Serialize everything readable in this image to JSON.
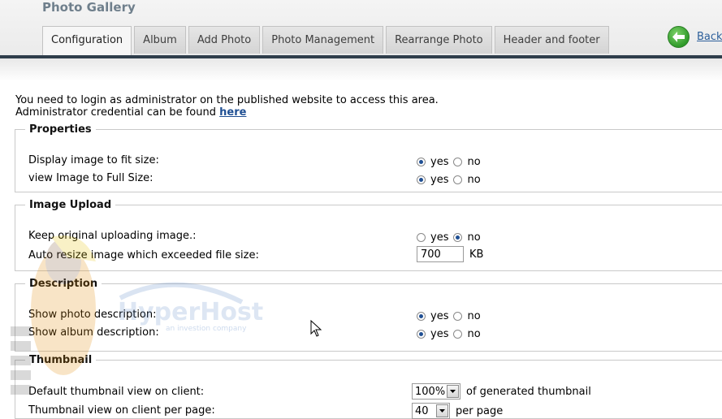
{
  "page": {
    "title": "Photo Gallery"
  },
  "tabs": [
    {
      "label": "Configuration",
      "active": true
    },
    {
      "label": "Album"
    },
    {
      "label": "Add Photo"
    },
    {
      "label": "Photo Management"
    },
    {
      "label": "Rearrange Photo"
    },
    {
      "label": "Header and footer"
    }
  ],
  "back": {
    "label": "Back",
    "icon": "arrow-left-icon"
  },
  "notice": {
    "line1": "You need to login as administrator on the published website to access this area.",
    "line2_prefix": "Administrator credential can be found ",
    "link": "here"
  },
  "options": {
    "yes": "yes",
    "no": "no"
  },
  "properties": {
    "legend": "Properties",
    "fit_size": {
      "label": "Display image to fit size:",
      "value": "yes"
    },
    "full_size": {
      "label": "view Image to Full Size:",
      "value": "yes"
    }
  },
  "upload": {
    "legend": "Image Upload",
    "keep_original": {
      "label": "Keep original uploading image.:",
      "value": "no"
    },
    "auto_resize": {
      "label": "Auto resize image which exceeded file size:",
      "value": "700",
      "unit": "KB"
    }
  },
  "description": {
    "legend": "Description",
    "photo": {
      "label": "Show photo description:",
      "value": "yes"
    },
    "album": {
      "label": "Show album description:",
      "value": "yes"
    }
  },
  "thumbnail": {
    "legend": "Thumbnail",
    "default_view": {
      "label": "Default thumbnail view on client:",
      "value": "100%",
      "suffix": "of generated thumbnail"
    },
    "per_page": {
      "label": "Thumbnail view on client per page:",
      "value": "40",
      "suffix": "per page"
    }
  },
  "watermark": {
    "brand": "HyperHost",
    "tagline": "an investion company"
  },
  "colors": {
    "accent": "#1f4f93",
    "tab_rule": "#2f3e4b",
    "back_green": "#2f9a2a"
  }
}
